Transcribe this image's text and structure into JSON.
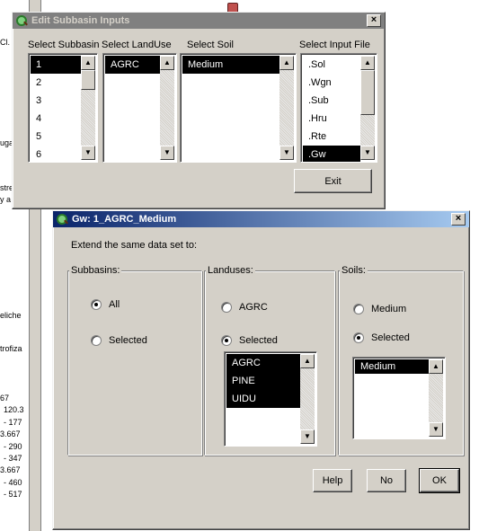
{
  "background": {
    "fragments": [
      "Cl.",
      "ugai",
      "stre",
      "y a",
      "eliche",
      "trofiza",
      "67",
      "120.3",
      "- 177",
      "3.667",
      "- 290",
      "- 347",
      "3.667",
      "- 460",
      "- 517"
    ]
  },
  "edit_window": {
    "title": "Edit Subbasin Inputs",
    "close": "×",
    "headers": {
      "subbasin": "Select Subbasin",
      "landuse": "Select LandUse",
      "soil": "Select Soil",
      "input_file": "Select Input File"
    },
    "subbasins": [
      "1",
      "2",
      "3",
      "4",
      "5",
      "6"
    ],
    "landuses": [
      "AGRC"
    ],
    "soils": [
      "Medium"
    ],
    "input_files": [
      ".Sol",
      ".Wgn",
      ".Sub",
      ".Hru",
      ".Rte",
      ".Gw"
    ],
    "exit_label": "Exit"
  },
  "gw_window": {
    "title": "Gw: 1_AGRC_Medium",
    "close": "×",
    "instruction": "Extend the same data set to:",
    "subbasins": {
      "title": "Subbasins:",
      "opt_all": "All",
      "opt_selected": "Selected"
    },
    "landuses": {
      "title": "Landuses:",
      "opt_single": "AGRC",
      "opt_selected": "Selected",
      "items": [
        "AGRC",
        "PINE",
        "UIDU"
      ]
    },
    "soils": {
      "title": "Soils:",
      "opt_single": "Medium",
      "opt_selected": "Selected",
      "items": [
        "Medium"
      ]
    },
    "help_label": "Help",
    "no_label": "No",
    "ok_label": "OK"
  },
  "icons": {
    "app_icon": "magnifier-globe-icon",
    "scroll_up": "arrow-up-icon",
    "scroll_down": "arrow-down-icon",
    "close": "close-icon"
  },
  "colors": {
    "active_title_start": "#0a246a",
    "active_title_end": "#a6caf0",
    "inactive_title": "#808080",
    "selection": "#000000",
    "face": "#d4d0c8"
  }
}
